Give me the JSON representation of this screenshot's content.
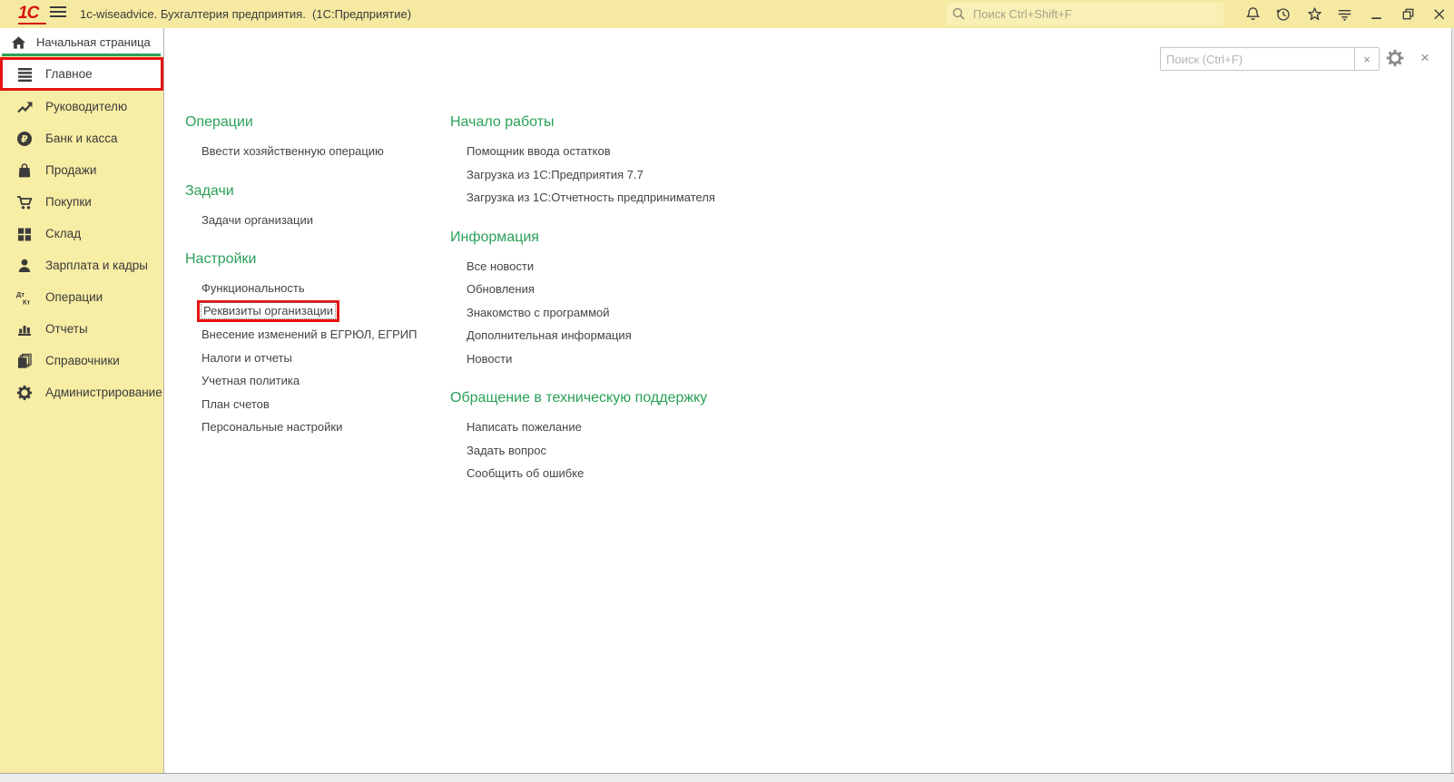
{
  "colors": {
    "topbar_yellow": "#f6eaa2",
    "sidebar_yellow": "#f8eda4",
    "accent_green": "#2aa159",
    "annotation_red": "#e81212",
    "logo_red": "#d6120f",
    "icon_dark": "#3b3b3b"
  },
  "window": {
    "logo": "1С",
    "title": "1c-wiseadvice. Бухгалтерия предприятия.  (1С:Предприятие)",
    "search_placeholder": "Поиск Ctrl+Shift+F"
  },
  "tabs": {
    "home": "Начальная страница"
  },
  "sidebar": {
    "items": [
      {
        "label": "Главное",
        "selected": true,
        "annotated": true
      },
      {
        "label": "Руководителю"
      },
      {
        "label": "Банк и касса"
      },
      {
        "label": "Продажи"
      },
      {
        "label": "Покупки"
      },
      {
        "label": "Склад"
      },
      {
        "label": "Зарплата и кадры"
      },
      {
        "label": "Операции"
      },
      {
        "label": "Отчеты"
      },
      {
        "label": "Справочники"
      },
      {
        "label": "Администрирование"
      }
    ]
  },
  "panel": {
    "search_placeholder": "Поиск (Ctrl+F)",
    "clear_label": "×",
    "close_label": "×"
  },
  "content": {
    "left": [
      {
        "heading": "Операции",
        "links": [
          "Ввести хозяйственную операцию"
        ]
      },
      {
        "heading": "Задачи",
        "links": [
          "Задачи организации"
        ]
      },
      {
        "heading": "Настройки",
        "links": [
          "Функциональность",
          "Реквизиты организации",
          "Внесение изменений в ЕГРЮЛ, ЕГРИП",
          "Налоги и отчеты",
          "Учетная политика",
          "План счетов",
          "Персональные настройки"
        ],
        "annotated_link": "Реквизиты организации"
      }
    ],
    "right": [
      {
        "heading": "Начало работы",
        "links": [
          "Помощник ввода остатков",
          "Загрузка из 1С:Предприятия 7.7",
          "Загрузка из 1С:Отчетность предпринимателя"
        ]
      },
      {
        "heading": "Информация",
        "links": [
          "Все новости",
          "Обновления",
          "Знакомство с программой",
          "Дополнительная информация",
          "Новости"
        ]
      },
      {
        "heading": "Обращение в техническую поддержку",
        "links": [
          "Написать пожелание",
          "Задать вопрос",
          "Сообщить об ошибке"
        ]
      }
    ]
  }
}
